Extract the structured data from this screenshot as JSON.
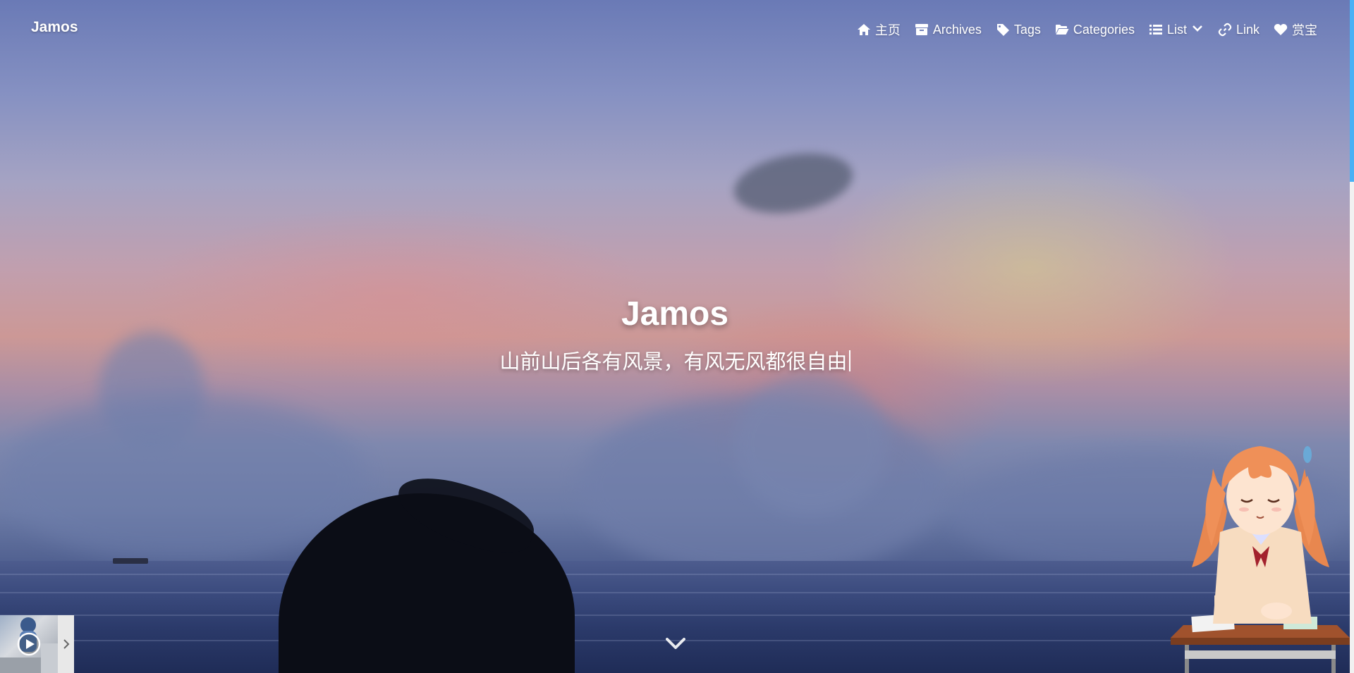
{
  "navbar": {
    "brand": "Jamos",
    "menu": [
      {
        "label": "主页",
        "icon": "home-icon"
      },
      {
        "label": "Archives",
        "icon": "archive-icon"
      },
      {
        "label": "Tags",
        "icon": "tag-icon"
      },
      {
        "label": "Categories",
        "icon": "folder-open-icon"
      },
      {
        "label": "List",
        "icon": "list-icon",
        "dropdown": true
      },
      {
        "label": "Link",
        "icon": "link-icon"
      },
      {
        "label": "赏宝",
        "icon": "heart-icon"
      }
    ]
  },
  "hero": {
    "title": "Jamos",
    "subtitle": "山前山后各有风景，有风无风都很自由"
  },
  "icons": {
    "scroll_down": "chevron-down-icon",
    "play": "play-circle-icon",
    "player_toggle": "chevron-right-icon"
  },
  "colors": {
    "accent": "#49b1f5",
    "text": "#ffffff"
  }
}
